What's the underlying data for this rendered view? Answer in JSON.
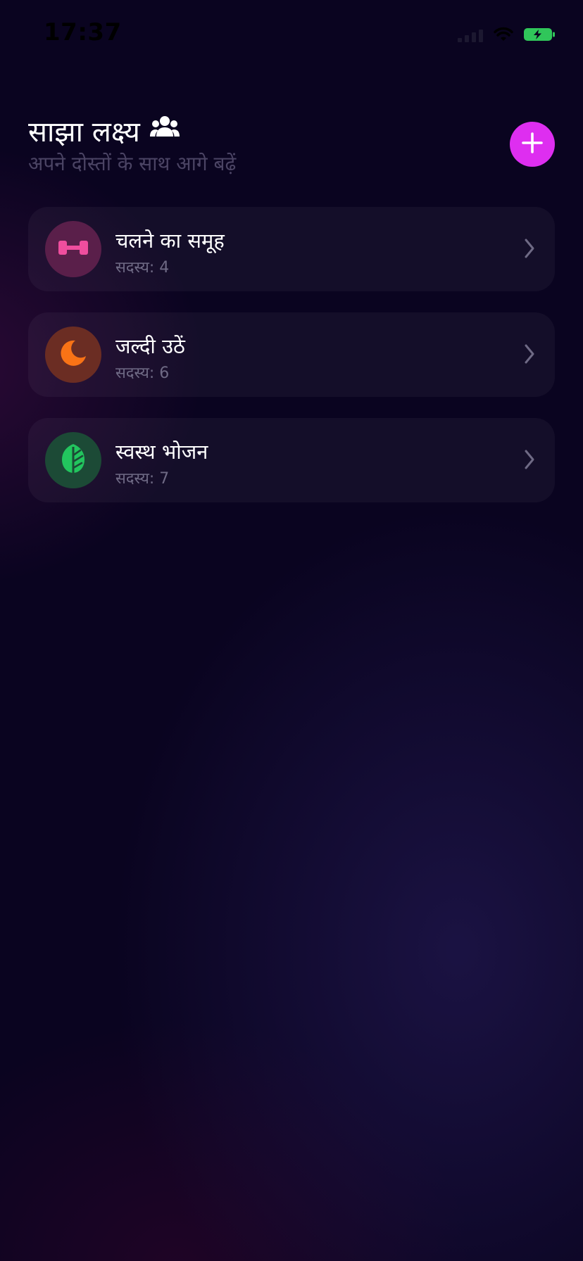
{
  "status_bar": {
    "time": "17:37"
  },
  "header": {
    "title": "साझा लक्ष्य",
    "title_icon": "group-icon",
    "subtitle": "अपने दोस्तों के साथ आगे बढ़ें",
    "add_button_icon": "plus-icon"
  },
  "colors": {
    "accent": "#de2ef0",
    "background": "#0a0420",
    "card": "#17122b",
    "subtitle": "#4b4464",
    "members_text": "#6f6a85"
  },
  "groups": [
    {
      "name": "चलने का समूह",
      "members": "सदस्य: 4",
      "icon": "dumbbell-icon",
      "icon_color": "#ef4e9e",
      "icon_bg": "#5a1f4a"
    },
    {
      "name": "जल्दी उठें",
      "members": "सदस्य: 6",
      "icon": "moon-icon",
      "icon_color": "#f97316",
      "icon_bg": "#6b2d23"
    },
    {
      "name": "स्वस्थ भोजन",
      "members": "सदस्य: 7",
      "icon": "leaf-icon",
      "icon_color": "#22c55e",
      "icon_bg": "#1c4a36"
    }
  ]
}
